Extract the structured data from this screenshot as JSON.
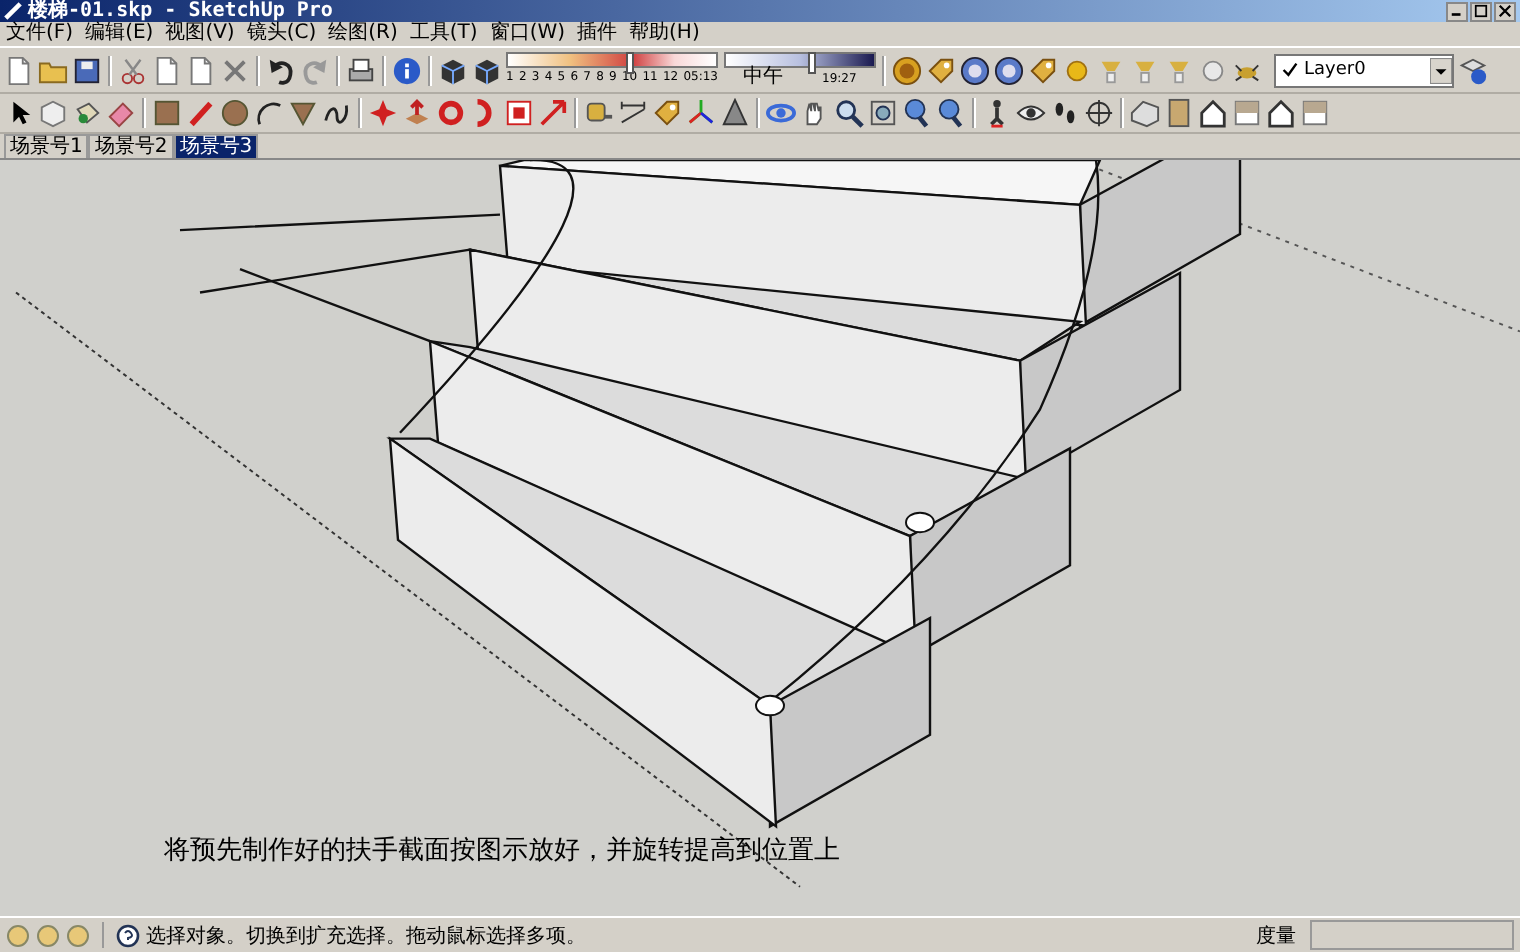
{
  "window": {
    "title": "楼梯-01.skp - SketchUp Pro"
  },
  "menu": [
    "文件(F)",
    "编辑(E)",
    "视图(V)",
    "镜头(C)",
    "绘图(R)",
    "工具(T)",
    "窗口(W)",
    "插件",
    "帮助(H)"
  ],
  "shadow_settings": {
    "months": [
      "1",
      "2",
      "3",
      "4",
      "5",
      "6",
      "7",
      "8",
      "9",
      "10",
      "11",
      "12"
    ],
    "date_slider": {
      "level": 0.57
    },
    "sunrise": "05:13",
    "noon": "中午",
    "sunset": "19:27",
    "time_slider": {
      "level": 0.55
    }
  },
  "layer": {
    "name": "Layer0"
  },
  "scene_tabs": [
    {
      "label": "场景号1",
      "selected": false
    },
    {
      "label": "场景号2",
      "selected": false
    },
    {
      "label": "场景号3",
      "selected": true
    }
  ],
  "caption": "将预先制作好的扶手截面按图示放好，并旋转提高到位置上",
  "status_bar": {
    "text": "选择对象。切换到扩充选择。拖动鼠标选择多项。",
    "measurements_label": "度量"
  }
}
